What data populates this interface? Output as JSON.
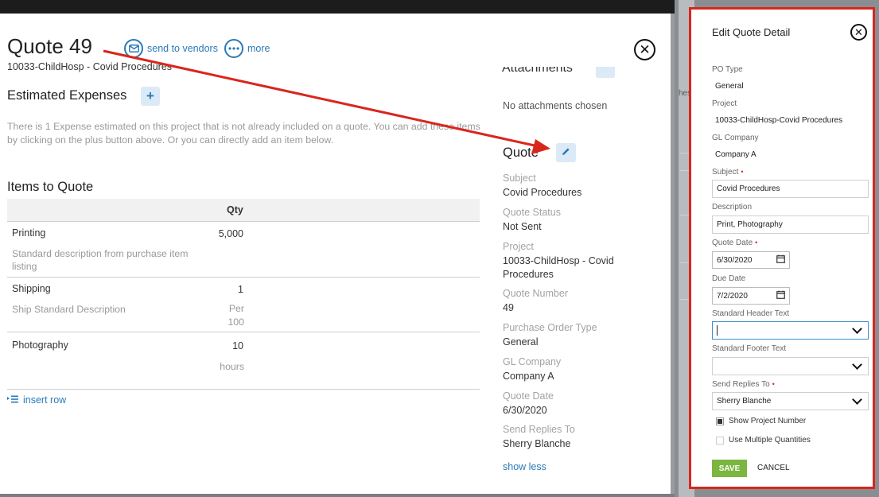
{
  "background": {
    "hint_text": "hes"
  },
  "quote": {
    "title": "Quote 49",
    "subtitle": "10033-ChildHosp - Covid Procedures",
    "actions": {
      "send_vendors": "send to vendors",
      "more": "more"
    }
  },
  "estimated": {
    "title": "Estimated Expenses",
    "text": "There is 1 Expense estimated on this project that is not already included on a quote. You can add these items by clicking on the plus button above. Or you can directly add an item below."
  },
  "items": {
    "title": "Items to Quote",
    "qty_header": "Qty",
    "rows": [
      {
        "name": "Printing",
        "description": "Standard description from purchase item listing",
        "qty": "5,000",
        "unit": ""
      },
      {
        "name": "Shipping",
        "description": "Ship Standard Description",
        "qty": "1",
        "unit": "Per 100"
      },
      {
        "name": "Photography",
        "description": "",
        "qty": "10",
        "unit": "hours"
      }
    ],
    "insert_row": "insert row"
  },
  "attachments": {
    "title": "Attachments",
    "empty_text": "No attachments chosen"
  },
  "quote_details": {
    "title": "Quote",
    "fields": [
      {
        "label": "Subject",
        "value": "Covid Procedures"
      },
      {
        "label": "Quote Status",
        "value": "Not Sent"
      },
      {
        "label": "Project",
        "value": "10033-ChildHosp - Covid Procedures"
      },
      {
        "label": "Quote Number",
        "value": "49"
      },
      {
        "label": "Purchase Order Type",
        "value": "General"
      },
      {
        "label": "GL Company",
        "value": "Company A"
      },
      {
        "label": "Quote Date",
        "value": "6/30/2020"
      },
      {
        "label": "Send Replies To",
        "value": "Sherry Blanche"
      }
    ],
    "show_less": "show less"
  },
  "panel": {
    "title": "Edit Quote Detail",
    "po_type": {
      "label": "PO Type",
      "value": "General"
    },
    "project": {
      "label": "Project",
      "value": "10033-ChildHosp-Covid Procedures"
    },
    "gl_company": {
      "label": "GL Company",
      "value": "Company A"
    },
    "subject": {
      "label": "Subject",
      "value": "Covid Procedures"
    },
    "description": {
      "label": "Description",
      "value": "Print, Photography"
    },
    "quote_date": {
      "label": "Quote Date",
      "value": "6/30/2020"
    },
    "due_date": {
      "label": "Due Date",
      "value": "7/2/2020"
    },
    "header_text": {
      "label": "Standard Header Text",
      "value": ""
    },
    "footer_text": {
      "label": "Standard Footer Text",
      "value": ""
    },
    "replies_to": {
      "label": "Send Replies To",
      "value": "Sherry Blanche"
    },
    "show_project_number": {
      "label": "Show Project Number",
      "checked": true
    },
    "multiple_quantities": {
      "label": "Use Multiple Quantities",
      "checked": false
    },
    "save": "SAVE",
    "cancel": "CANCEL",
    "required_mark": "•"
  },
  "colors": {
    "accent": "#2a7ab8",
    "highlight": "#d9261c",
    "save": "#7ab640"
  }
}
